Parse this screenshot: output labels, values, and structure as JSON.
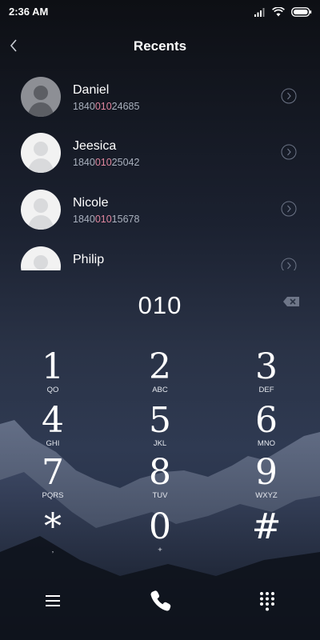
{
  "status": {
    "time": "2:36 AM"
  },
  "header": {
    "title": "Recents"
  },
  "recents": [
    {
      "name": "Daniel",
      "number_pre": "1840",
      "number_match": "010",
      "number_post": "24685"
    },
    {
      "name": "Jeesica",
      "number_pre": "1840",
      "number_match": "010",
      "number_post": "25042"
    },
    {
      "name": "Nicole",
      "number_pre": "1840",
      "number_match": "010",
      "number_post": "15678"
    },
    {
      "name": "Philip",
      "number_pre": "",
      "number_match": "",
      "number_post": ""
    }
  ],
  "dialer": {
    "input": "010"
  },
  "keys": [
    {
      "digit": "1",
      "sub": "QO"
    },
    {
      "digit": "2",
      "sub": "ABC"
    },
    {
      "digit": "3",
      "sub": "DEF"
    },
    {
      "digit": "4",
      "sub": "GHI"
    },
    {
      "digit": "5",
      "sub": "JKL"
    },
    {
      "digit": "6",
      "sub": "MNO"
    },
    {
      "digit": "7",
      "sub": "PQRS"
    },
    {
      "digit": "8",
      "sub": "TUV"
    },
    {
      "digit": "9",
      "sub": "WXYZ"
    },
    {
      "digit": "*",
      "sub": ","
    },
    {
      "digit": "0",
      "sub": "+"
    },
    {
      "digit": "#",
      "sub": ""
    }
  ],
  "colors": {
    "match_highlight": "#e0869e",
    "accent": "#ffffff"
  },
  "icons": {
    "back": "back-chevron-icon",
    "backspace": "backspace-icon",
    "menu": "menu-icon",
    "call": "phone-icon",
    "keypad": "dialpad-icon"
  }
}
